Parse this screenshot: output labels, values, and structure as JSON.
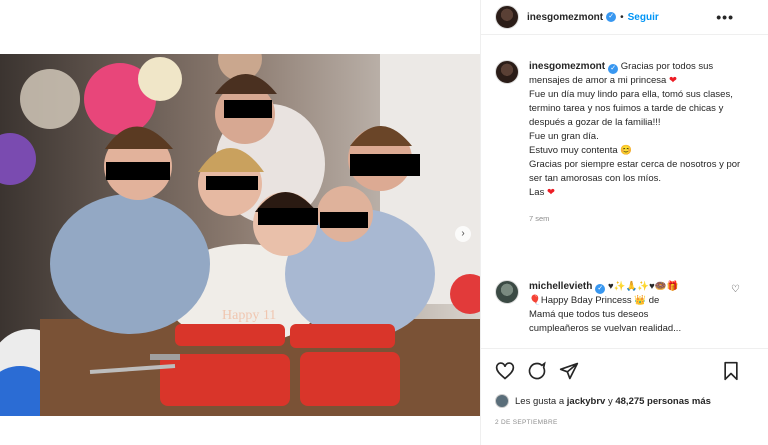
{
  "post": {
    "username": "inesgomezmont",
    "follow_label": "Seguir",
    "separator": "•",
    "more_label": "•••",
    "caption_lines": [
      "Gracias por todos sus mensajes de amor a mi princesa",
      "Fue un día muy lindo para ella, tomó sus clases, termino tarea y nos fuimos a tarde de chicas y después a gozar de la familia!!!",
      "Fue un gran día.",
      "Estuvo muy contenta",
      "Gracias por siempre estar cerca de nosotros y por ser tan amorosas con los míos.",
      "Las"
    ],
    "caption_emoji": {
      "heart": "❤",
      "smile": "😊"
    },
    "time_ago": "7 sem",
    "date": "2 DE SEPTIEMBRE"
  },
  "comment": {
    "username": "michellevieth",
    "emojis": "♥✨🙏✨♥🍩🎁",
    "text_lines": [
      "🎈Happy Bday Princess 👑 de",
      "Mamá que todos tus deseos",
      "cumpleañeros se vuelvan realidad..."
    ]
  },
  "likes": {
    "text_prefix": "Les gusta a",
    "user": "jackybrv",
    "text_mid": "y",
    "count": "48,275 personas más"
  },
  "image": {
    "cake_text": "Happy 11",
    "colors": {
      "balloon_pink": "#e8467a",
      "balloon_blue": "#2b6cd4",
      "cake_red": "#d9352a"
    }
  }
}
